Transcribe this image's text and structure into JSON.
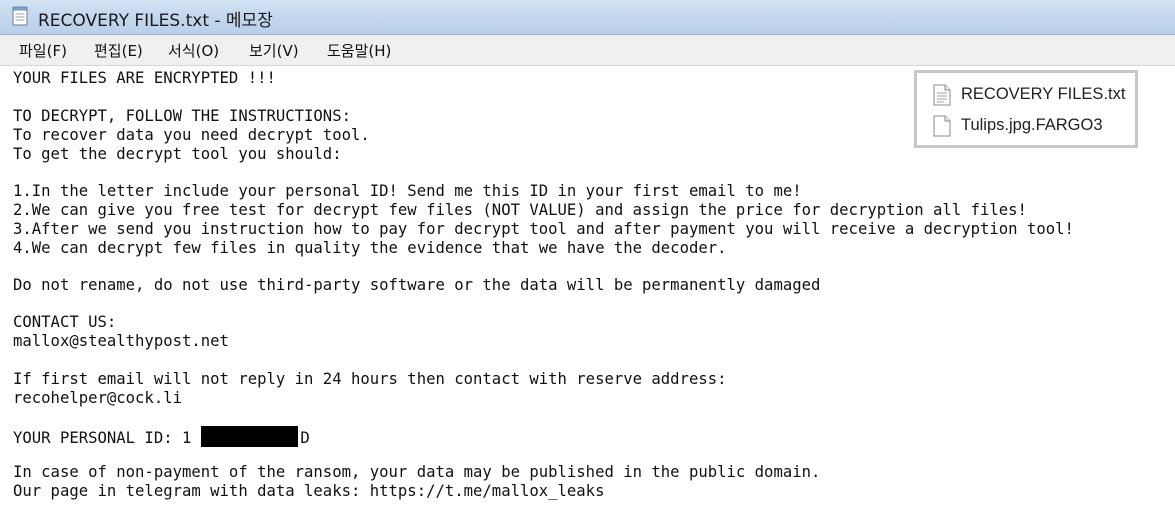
{
  "window": {
    "title": "RECOVERY FILES.txt - 메모장"
  },
  "menu": {
    "items": [
      "파일(F)",
      "편집(E)",
      "서식(O)",
      "보기(V)",
      "도움말(H)"
    ]
  },
  "document": {
    "lines": [
      "YOUR FILES ARE ENCRYPTED !!!",
      "",
      "TO DECRYPT, FOLLOW THE INSTRUCTIONS:",
      "To recover data you need decrypt tool.",
      "To get the decrypt tool you should:",
      "",
      "1.In the letter include your personal ID! Send me this ID in your first email to me!",
      "2.We can give you free test for decrypt few files (NOT VALUE) and assign the price for decryption all files!",
      "3.After we send you instruction how to pay for decrypt tool and after payment you will receive a decryption tool!",
      "4.We can decrypt few files in quality the evidence that we have the decoder.",
      "",
      "Do not rename, do not use third-party software or the data will be permanently damaged",
      "",
      "CONTACT US:",
      "mallox@stealthypost.net",
      "",
      "If first email will not reply in 24 hours then contact with reserve address:",
      "recohelper@cock.li",
      "",
      "",
      "",
      "In case of non-payment of the ransom, your data may be published in the public domain.",
      "Our page in telegram with data leaks: https://t.me/mallox_leaks"
    ],
    "personal_id_prefix": "YOUR PERSONAL ID: 1",
    "personal_id_suffix": "D"
  },
  "file_listing": {
    "files": [
      {
        "name": "RECOVERY FILES.txt",
        "icon": "text-file-icon"
      },
      {
        "name": "Tulips.jpg.FARGO3",
        "icon": "blank-file-icon"
      }
    ]
  },
  "colors": {
    "titlebar": "#c4d8ee",
    "menubar": "#f0f0f0",
    "text": "#111111",
    "redaction": "#000000"
  }
}
